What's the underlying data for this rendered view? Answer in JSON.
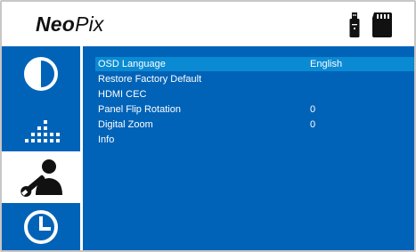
{
  "header": {
    "brand_bold": "Neo",
    "brand_regular": "Pix",
    "icons": [
      "usb-drive-icon",
      "sd-card-icon"
    ]
  },
  "sidebar": {
    "tabs": [
      {
        "icon": "picture-mode-icon",
        "selected": false
      },
      {
        "icon": "audio-equalizer-icon",
        "selected": false
      },
      {
        "icon": "settings-user-icon",
        "selected": true
      },
      {
        "icon": "clock-icon",
        "selected": false
      }
    ]
  },
  "menu": {
    "items": [
      {
        "label": "OSD Language",
        "value": "English",
        "selected": true
      },
      {
        "label": "Restore Factory Default",
        "value": ""
      },
      {
        "label": "HDMI CEC",
        "value": ""
      },
      {
        "label": "Panel Flip Rotation",
        "value": "0"
      },
      {
        "label": "Digital Zoom",
        "value": "0"
      },
      {
        "label": "Info",
        "value": ""
      }
    ]
  },
  "colors": {
    "panel_blue": "#0063b8",
    "highlight_blue": "#0a8ad3",
    "text": "#ffffff"
  }
}
